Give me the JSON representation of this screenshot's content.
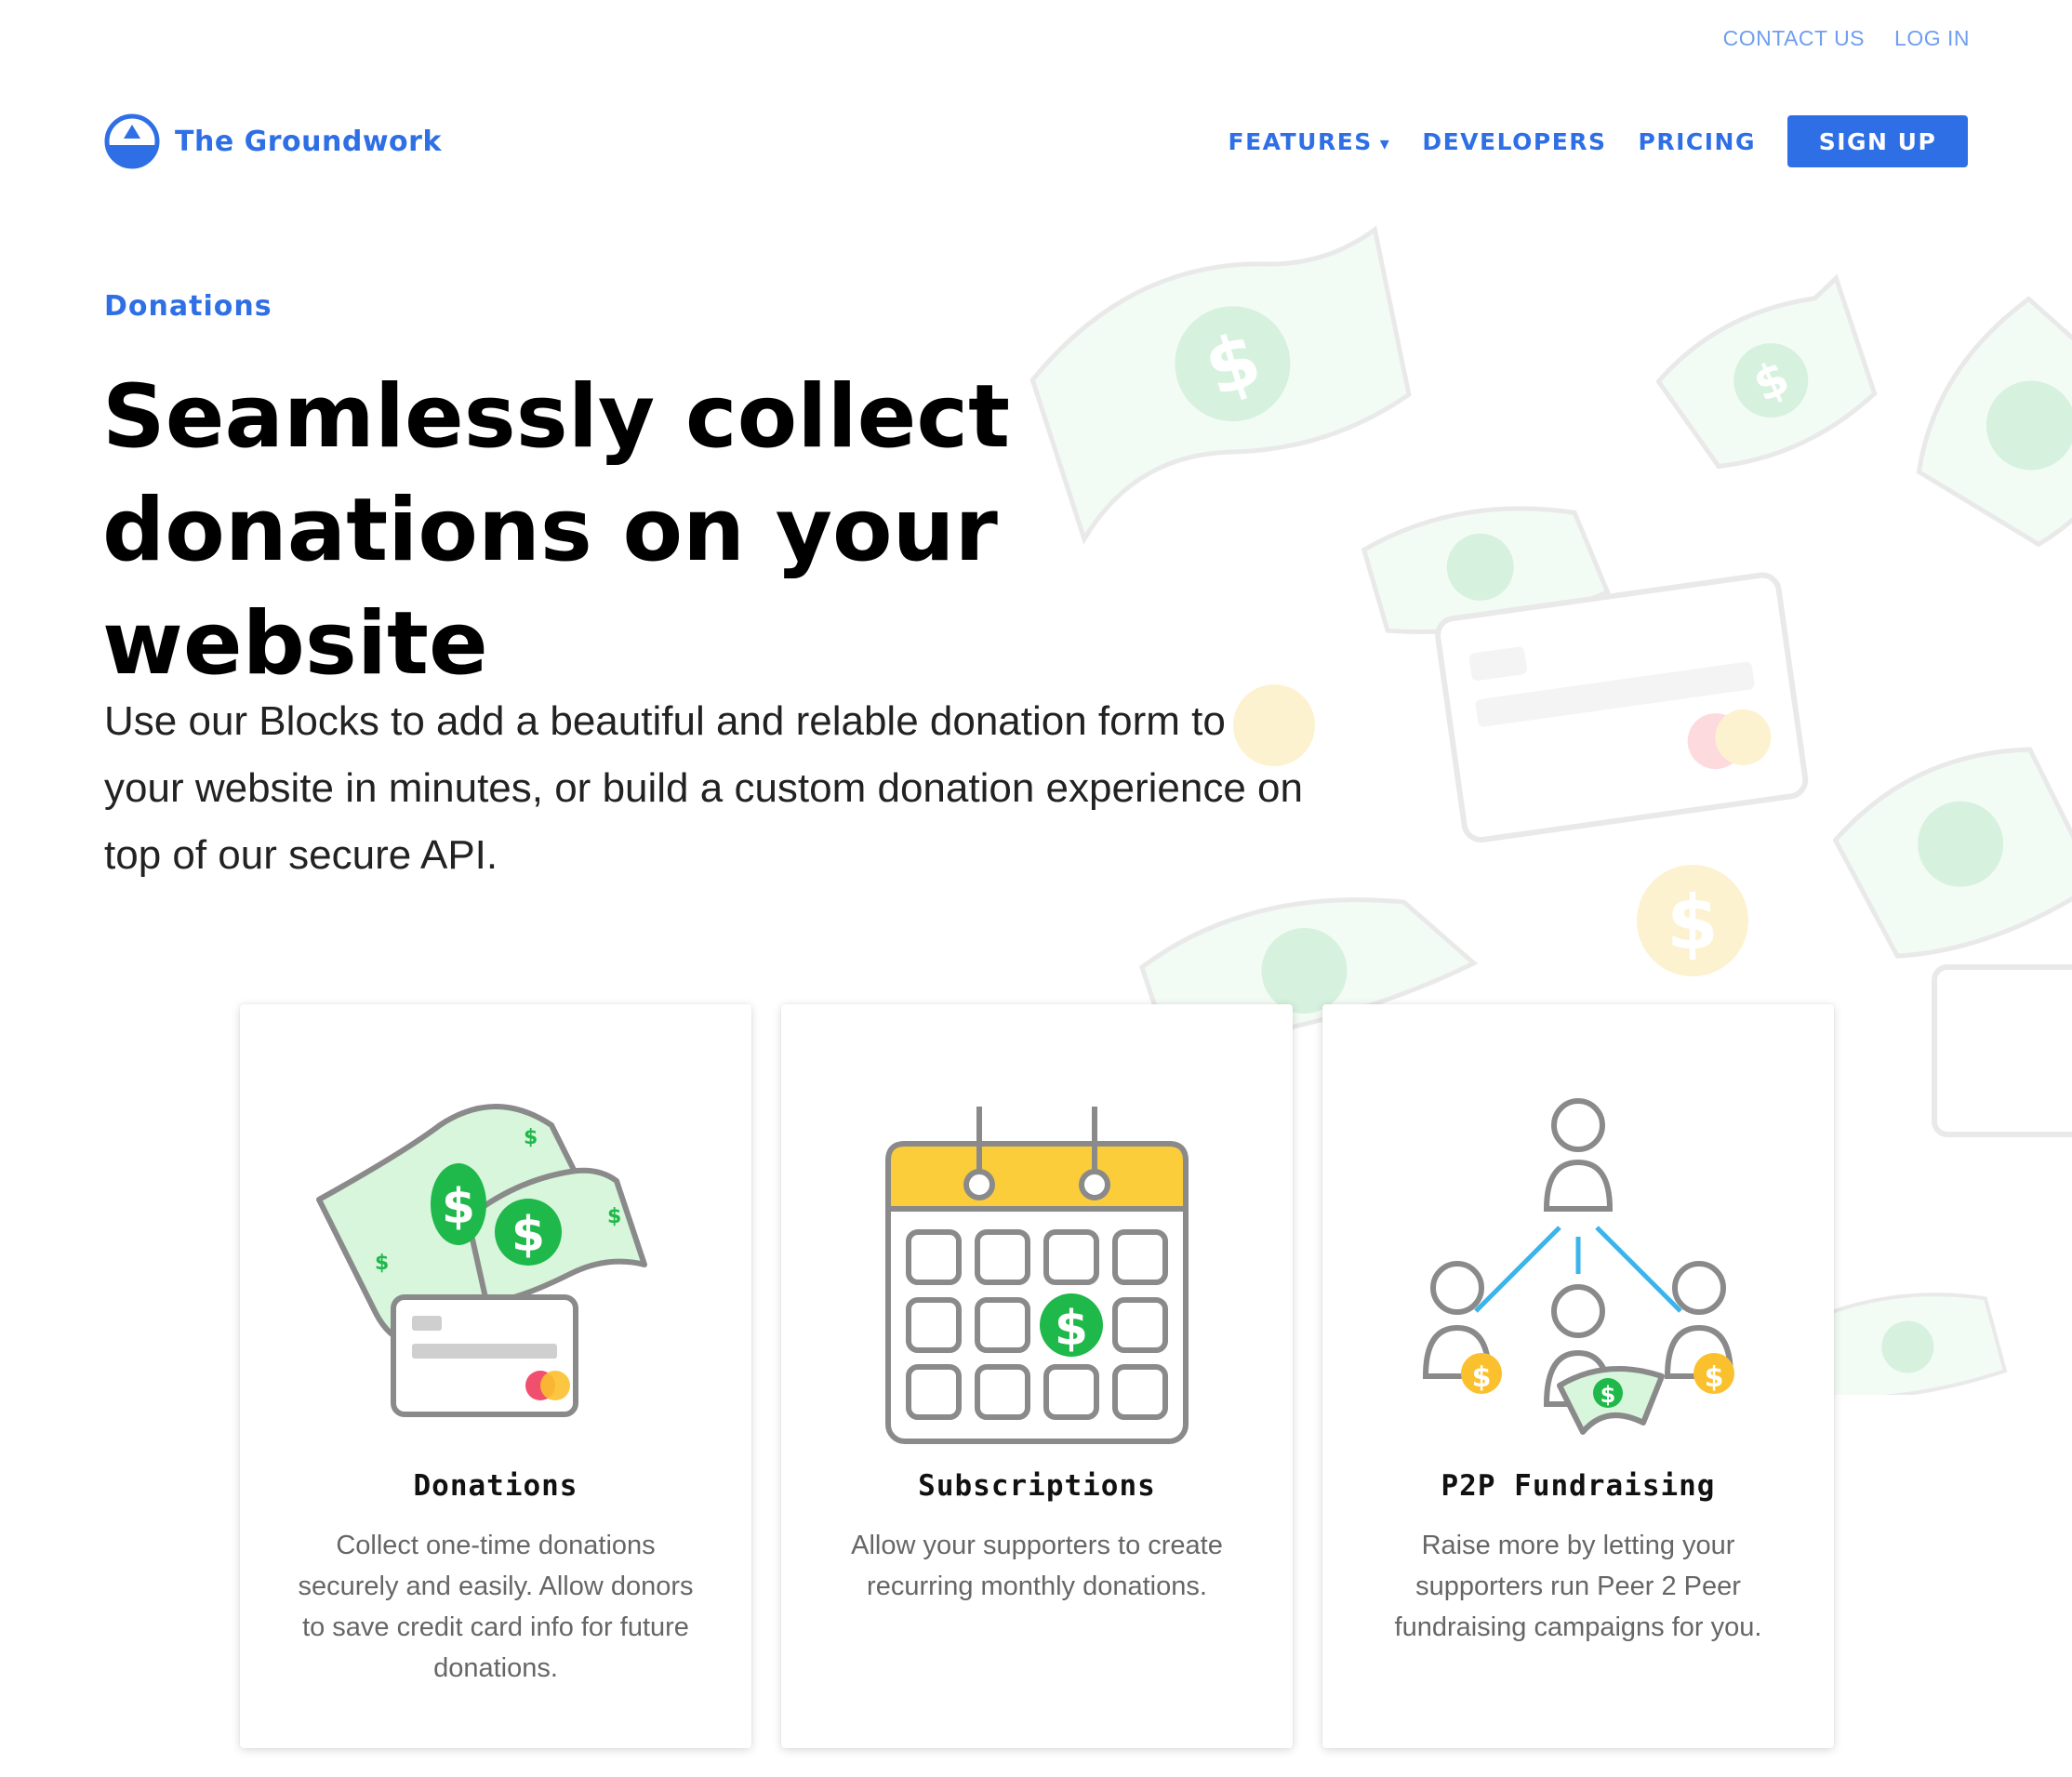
{
  "colors": {
    "brand": "#2f6fe5",
    "money_green": "#1fb84a",
    "coin_yellow": "#f8cc2e",
    "calendar_yellow": "#fbcd3a",
    "line_blue": "#3bb4ec"
  },
  "utility_nav": {
    "contact": "CONTACT US",
    "login": "LOG IN"
  },
  "logo": {
    "text": "The Groundwork"
  },
  "main_nav": {
    "features": "FEATURES",
    "features_caret": "▾",
    "developers": "DEVELOPERS",
    "pricing": "PRICING",
    "signup": "SIGN UP"
  },
  "hero": {
    "eyebrow": "Donations",
    "title": "Seamlessly collect donations on your website",
    "subtitle": "Use our Blocks to add a beautiful and relable donation form to your website in minutes, or build a custom donation experience on top of our secure API."
  },
  "cards": [
    {
      "title": "Donations",
      "description": "Collect one-time donations securely and easily. Allow donors to save credit card info for future donations.",
      "icon": "cash-and-card-icon"
    },
    {
      "title": "Subscriptions",
      "description": "Allow your supporters to create recurring monthly donations.",
      "icon": "calendar-dollar-icon"
    },
    {
      "title": "P2P Fundraising",
      "description": "Raise more by letting your supporters run Peer 2 Peer fundraising campaigns for you.",
      "icon": "network-people-icon"
    }
  ]
}
